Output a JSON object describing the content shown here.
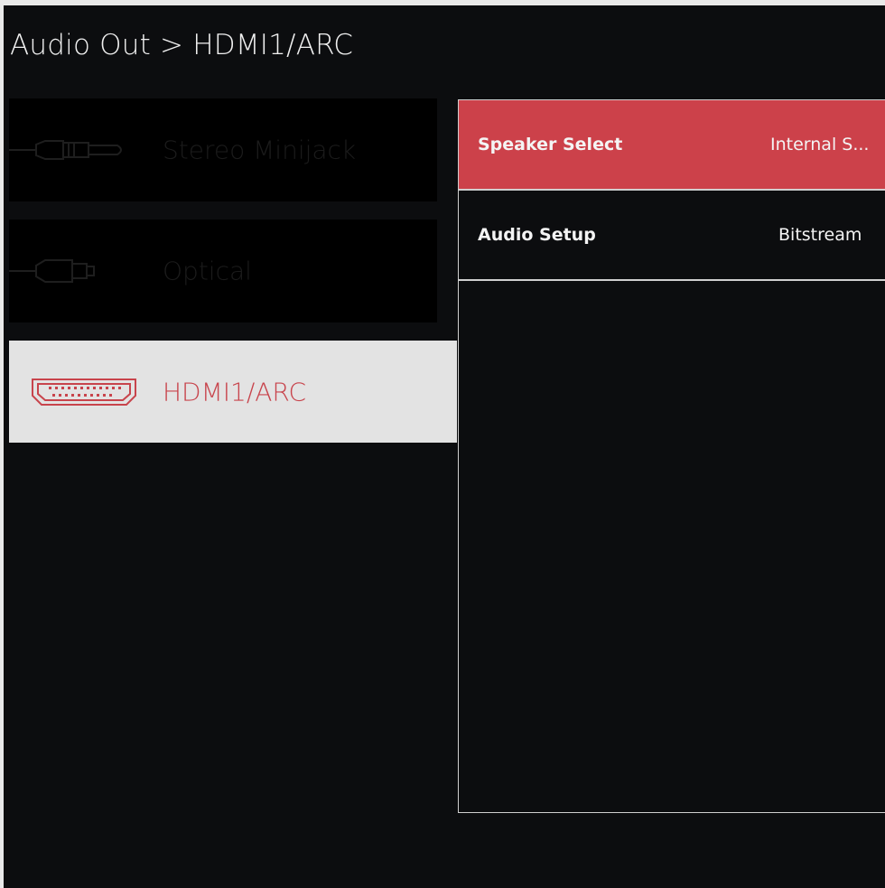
{
  "header": {
    "breadcrumb": "Audio Out > HDMI1/ARC"
  },
  "sources": [
    {
      "label": "Stereo Minijack",
      "icon": "minijack-icon",
      "selected": false
    },
    {
      "label": "Optical",
      "icon": "optical-icon",
      "selected": false
    },
    {
      "label": "HDMI1/ARC",
      "icon": "hdmi-icon",
      "selected": true
    }
  ],
  "settings": [
    {
      "label": "Speaker Select",
      "value": "Internal S...",
      "active": true
    },
    {
      "label": "Audio Setup",
      "value": "Bitstream",
      "active": false
    }
  ],
  "colors": {
    "accent": "#cc414a",
    "background": "#0c0d0f",
    "selected_bg": "#e3e3e3",
    "dim_text": "#1b1b1b"
  }
}
